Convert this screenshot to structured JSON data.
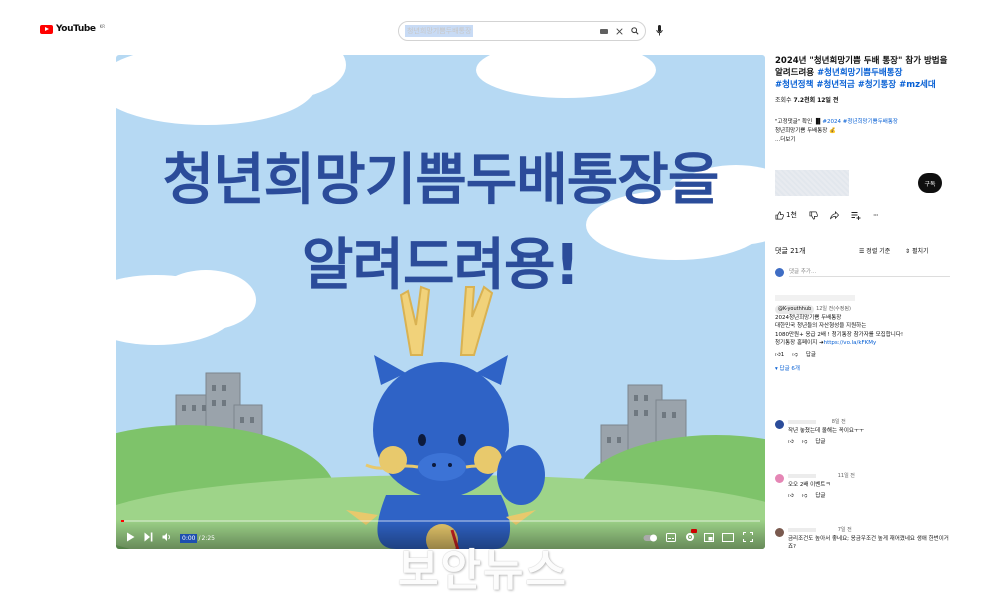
{
  "header": {
    "logo_text": "YouTube",
    "logo_sup": "KR",
    "search_query": "청년희망기쁨두배통장"
  },
  "video": {
    "overlay_line1": "청년희망기쁨두배통장을",
    "overlay_line2": "알려드려용!",
    "time_current": "0:00",
    "time_duration": "2:25",
    "progress_fraction": 0.004
  },
  "side": {
    "title_plain": "2024년 \"청년희망기쁨 두배 통장\" 참가 방법을 알려드려용 ",
    "title_tags_1": "#청년희망기쁨두배통장",
    "title_tags_2": "#청년정책 #청년적금 #청기통장 #mz세대",
    "views_label": "조회수 ",
    "views_value": "7.2천회",
    "uploaded": "12일 전",
    "desc_line1_prefix": "\"고정댓글\" 확인 ",
    "desc_line1_tags": "#2024 #청년희망기쁨두배통장",
    "desc_line2": "청년희망기쁨 두배통장 💰",
    "desc_more": "...더보기",
    "subscribe_label": "구독",
    "like_count": "1천",
    "comments_count": "댓글 21개",
    "sort_label": "정렬 기준",
    "expand_label": "펼치기",
    "add_comment_placeholder": "댓글 추가..."
  },
  "comments": [
    {
      "author": "@K-youthhub",
      "time": "12일 전(수정됨)",
      "lines": [
        "2024청년희망기쁨 두배통장",
        "대한민국 청년들의 자산형성을 지원하는",
        "1080만원+ 응급 2배 ! 청기통장 참가자를 모집합니다!",
        "청기통장 홈페이지 ➜"
      ],
      "link": "https://vo.la/kFKMy",
      "likes": "1",
      "reply_label": "답글",
      "replies_label": "답글 6개"
    },
    {
      "time": "8일 전",
      "text": "작년 놓쳤는데 올해는 꼭이요ㅜㅜ",
      "reply_label": "답글"
    },
    {
      "time": "11일 전",
      "text": "오오 2배 이벤트ㅋ",
      "reply_label": "답글"
    },
    {
      "time": "7일 전",
      "text": "금리조건도 높아서 좋네요; 응금우조건 높게 재어꼈네요 생애 한번이거죠?"
    }
  ],
  "watermark": "보안뉴스",
  "colors": {
    "brand_red": "#ff0000",
    "link_blue": "#065fd4",
    "headline_blue": "#2b4c9a",
    "sky": "#b6d9f3"
  }
}
